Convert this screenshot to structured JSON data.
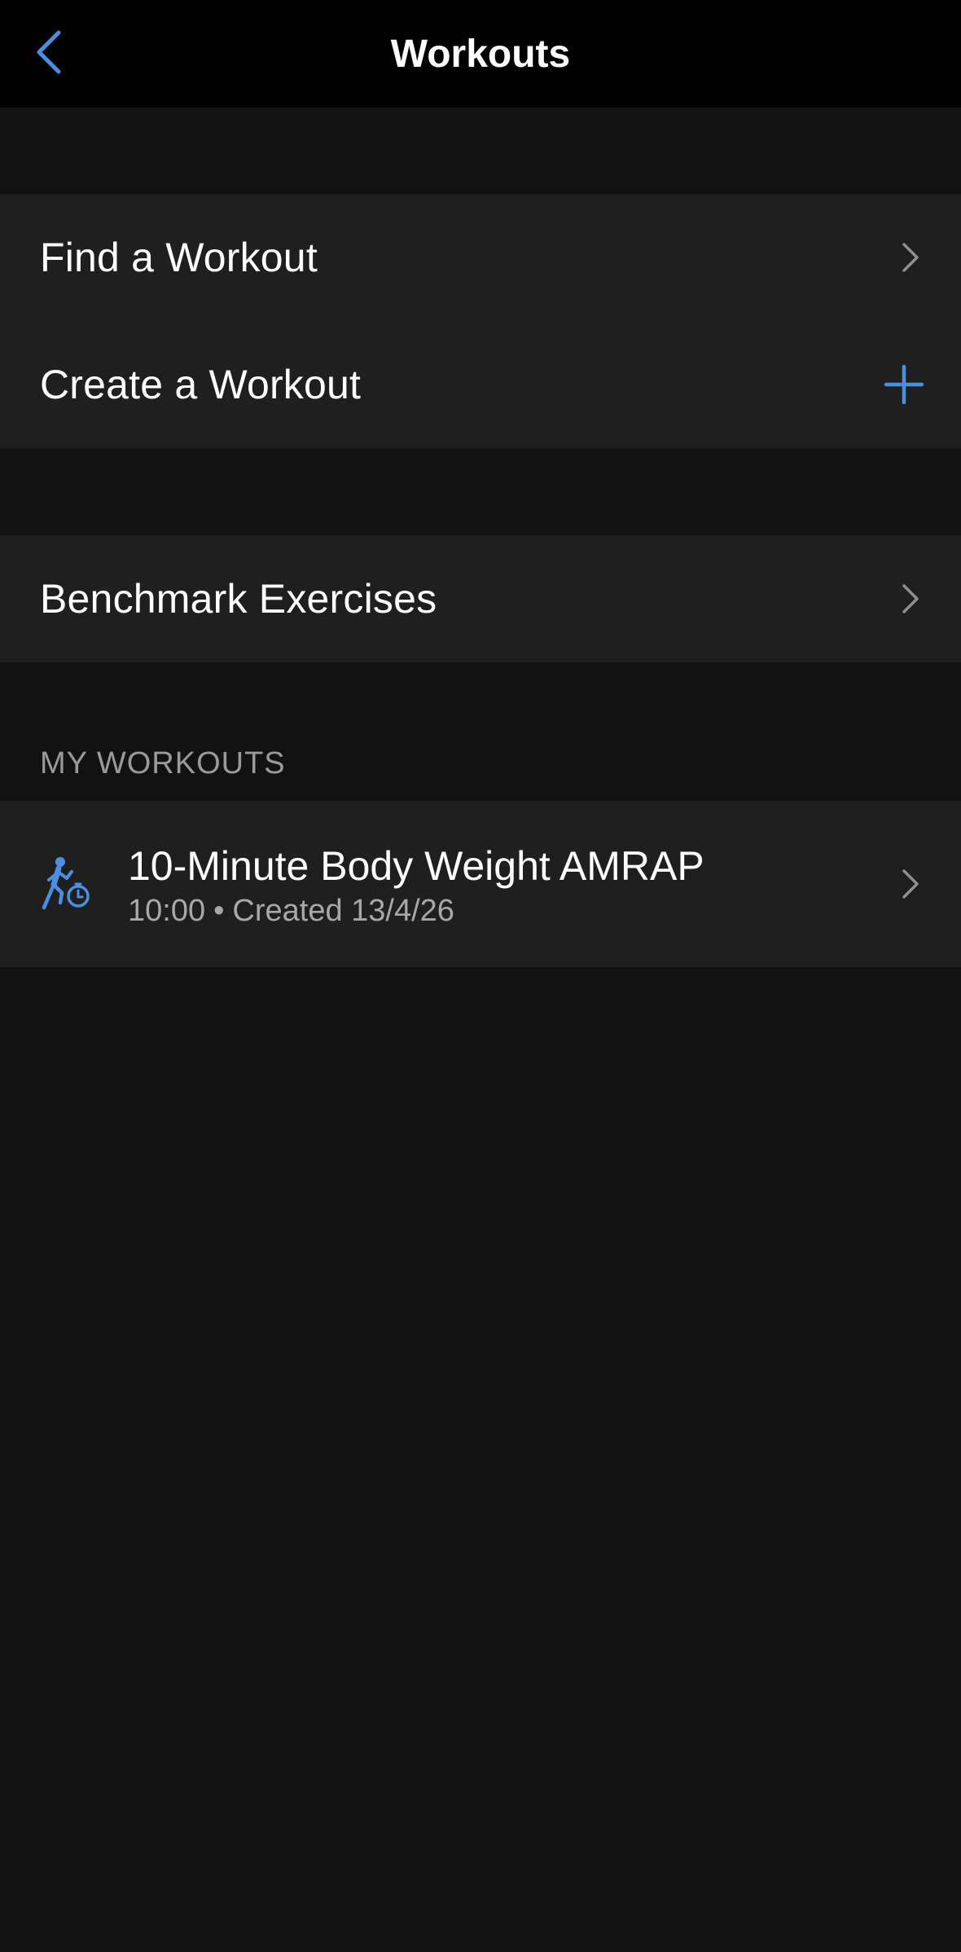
{
  "nav": {
    "title": "Workouts",
    "back_icon": "chevron-left-icon"
  },
  "colors": {
    "accent": "#4a90e2",
    "background": "#121212",
    "row_background": "#1f1f1f",
    "navbar_background": "#000000",
    "secondary_text": "#a8a8a8",
    "chevron": "#8e8e93"
  },
  "group1": {
    "find_workout": "Find a Workout",
    "create_workout": "Create a Workout"
  },
  "group2": {
    "benchmark": "Benchmark Exercises"
  },
  "my_workouts": {
    "header": "MY WORKOUTS",
    "items": [
      {
        "title": "10-Minute Body Weight AMRAP",
        "duration": "10:00",
        "separator": "•",
        "created": "Created 13/4/26",
        "icon": "running-timer-icon"
      }
    ]
  }
}
